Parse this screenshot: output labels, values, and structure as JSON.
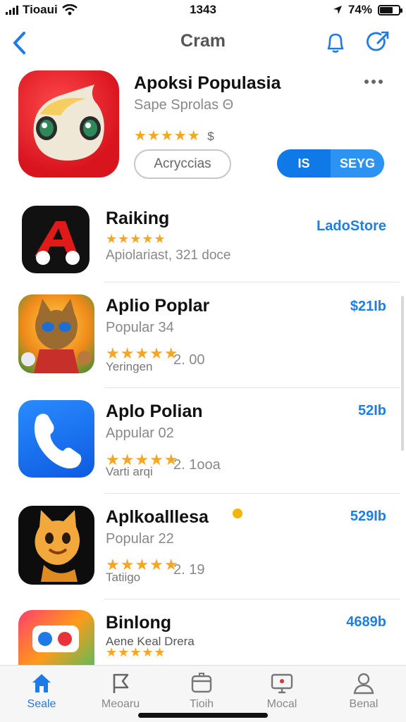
{
  "status": {
    "carrier": "Tioaui",
    "time": "1343",
    "battery": "74%"
  },
  "nav": {
    "title": "Cram",
    "back_icon": "chevron-left-icon",
    "bell_icon": "bell-icon",
    "compose_icon": "compose-icon",
    "accent": "#1e7ae6"
  },
  "featured": {
    "title": "Apoksi Populasia",
    "subtitle": "Sape Sprolas Θ",
    "stars": "★★★★★",
    "stars_suffix": "$",
    "secondary_button": "Acryccias",
    "split_left": "IS",
    "split_right": "SEYG",
    "more_icon": "more-icon"
  },
  "list": [
    {
      "title": "Raiking",
      "subtitle": "",
      "stars": "★★★★★",
      "meta": "Apiolariast, 321 doce",
      "extra": "",
      "price": "LadoStore",
      "icon": "red-a-app-icon"
    },
    {
      "title": "Aplio Poplar",
      "subtitle": "Popular 34",
      "stars": "★★★★★",
      "meta": "2. 00",
      "extra": "Yeringen",
      "price": "$21Ib",
      "icon": "cat-game-icon"
    },
    {
      "title": "Aplo Polian",
      "subtitle": "Appular 02",
      "stars": "★★★★★",
      "meta": "2. 1ooa",
      "extra": "Varti arqi",
      "price": "52Ib",
      "icon": "phone-app-icon"
    },
    {
      "title": "Aplkoalllesa",
      "subtitle": "Popular 22",
      "stars": "★★★★★",
      "meta": "2. 19",
      "extra": "Tatiigo",
      "price": "529Ib",
      "icon": "fox-app-icon"
    },
    {
      "title": "Binlong",
      "subtitle": "",
      "stars": "★★★★★",
      "meta": "Aene Keal Drera",
      "extra": "",
      "price": "4689b",
      "icon": "social-app-icon"
    }
  ],
  "tabs": [
    {
      "label": "Seale",
      "icon": "home-icon",
      "active": true
    },
    {
      "label": "Meoaru",
      "icon": "flag-icon",
      "active": false
    },
    {
      "label": "Tioih",
      "icon": "box-icon",
      "active": false
    },
    {
      "label": "Mocal",
      "icon": "display-icon",
      "active": false
    },
    {
      "label": "Benal",
      "icon": "person-icon",
      "active": false
    }
  ]
}
